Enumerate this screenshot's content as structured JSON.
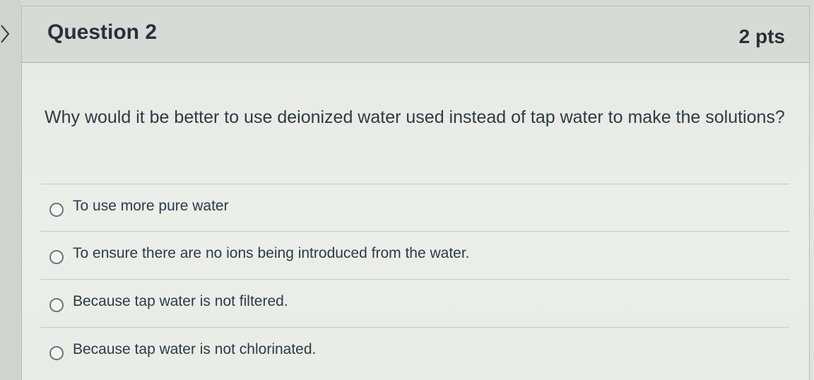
{
  "question": {
    "title": "Question 2",
    "points": "2 pts",
    "text": "Why would it be better to use deionized water used instead of tap water to make the solutions?",
    "answers": [
      {
        "label": "To use more pure water"
      },
      {
        "label": "To ensure there are no ions being introduced from the water."
      },
      {
        "label": "Because tap water is not filtered."
      },
      {
        "label": "Because tap water is not chlorinated."
      }
    ]
  },
  "icons": {
    "left_nav": "chevron-right-icon",
    "answer_control": "radio-button-icon"
  },
  "colors": {
    "header_bg": "#d7dbd6",
    "text": "#2d3b45",
    "border": "#a9ada9"
  }
}
